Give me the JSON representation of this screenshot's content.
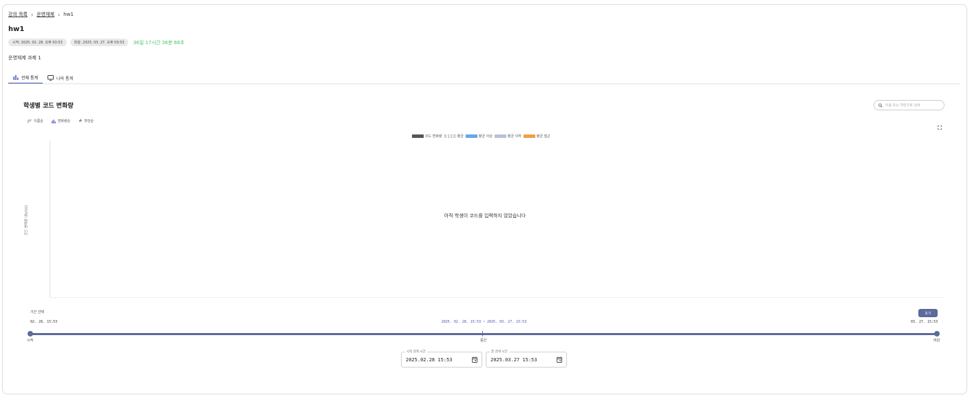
{
  "breadcrumb": {
    "items": [
      "강의 목록",
      "운영체제",
      "hw1"
    ]
  },
  "page": {
    "title": "hw1",
    "start_chip": "시작: 2025. 02. 28. 오후 03:53",
    "end_chip": "마감: 2025. 03. 27. 오후 03:53",
    "remaining": "36일 17시간 36분 66초",
    "description": "운영체제 과제 1"
  },
  "tabs": [
    {
      "label": "전체 통계",
      "icon": "bar-chart-icon",
      "active": true
    },
    {
      "label": "나의 통계",
      "icon": "monitor-icon",
      "active": false
    }
  ],
  "panel": {
    "title": "학생별 코드 변화량",
    "search_placeholder": "이름 또는 학번으로 검색",
    "sort_buttons": [
      {
        "label": "이름순",
        "icon": "sort-icon"
      },
      {
        "label": "변화량순",
        "icon": "bar-chart-icon"
      },
      {
        "label": "학번순",
        "icon": "hash-icon"
      }
    ]
  },
  "chart": {
    "legend": [
      {
        "label": "코드 변화량",
        "color": "#555555"
      },
      {
        "label": "평균",
        "color": "#cccccc"
      },
      {
        "label": "평균 이상",
        "color": "#64a8e8"
      },
      {
        "label": "평균 이하",
        "color": "#b8c0dc"
      },
      {
        "label": "평균 접근",
        "color": "#f0a040"
      }
    ],
    "y_label": "코드 변화량 (Bytes)",
    "empty_message": "아직 학생이 코드를 입력하지 않았습니다"
  },
  "range": {
    "label": "기간 선택",
    "reset_label": "초기",
    "start_time": "02. 28. 15:53",
    "selected_range": "2025. 02. 28. 15:53 ~ 2025. 03. 27. 15:53",
    "end_time": "03. 27. 15:53",
    "mark_start": "시작",
    "mark_middle": "중간",
    "mark_end": "마감",
    "start_field_label": "시작 검색 시간",
    "start_field_value": "2025.02.28 15:53",
    "end_field_label": "끝 검색 시간",
    "end_field_value": "2025.03.27 15:53"
  },
  "colors": {
    "accent": "#3f51b5",
    "slider": "#5c6a9c",
    "remaining": "#4cc46a"
  }
}
